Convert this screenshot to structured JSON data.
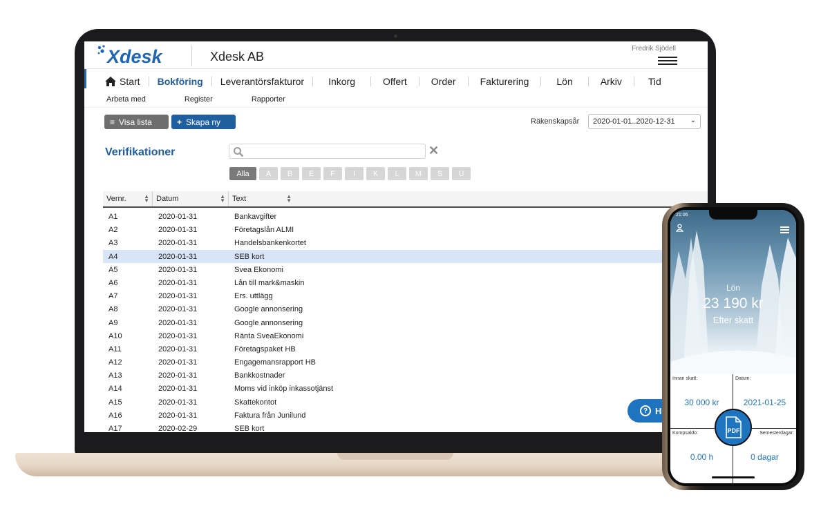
{
  "header": {
    "logo_text": "Xdesk",
    "company": "Xdesk AB",
    "user": "Fredrik Sjödell"
  },
  "nav": {
    "items": [
      {
        "label": "Start"
      },
      {
        "label": "Bokföring"
      },
      {
        "label": "Leverantörsfakturor"
      },
      {
        "label": "Inkorg"
      },
      {
        "label": "Offert"
      },
      {
        "label": "Order"
      },
      {
        "label": "Fakturering"
      },
      {
        "label": "Lön"
      },
      {
        "label": "Arkiv"
      },
      {
        "label": "Tid"
      }
    ],
    "active": "Bokföring",
    "sub_items": [
      {
        "label": "Arbeta med"
      },
      {
        "label": "Register"
      },
      {
        "label": "Rapporter"
      }
    ]
  },
  "toolbar": {
    "list_label": "Visa lista",
    "create_label": "Skapa ny",
    "year_label": "Räkenskapsår",
    "year_value": "2020-01-01..2020-12-31"
  },
  "page": {
    "title": "Verifikationer",
    "search_placeholder": ""
  },
  "letters": [
    "Alla",
    "A",
    "B",
    "E",
    "F",
    "I",
    "K",
    "L",
    "M",
    "S",
    "U"
  ],
  "table": {
    "columns": [
      "Vernr.",
      "Datum",
      "Text"
    ],
    "rows": [
      [
        "A1",
        "2020-01-31",
        "Bankavgifter"
      ],
      [
        "A2",
        "2020-01-31",
        "Företagslån ALMI"
      ],
      [
        "A3",
        "2020-01-31",
        "Handelsbankenkortet"
      ],
      [
        "A4",
        "2020-01-31",
        "SEB kort"
      ],
      [
        "A5",
        "2020-01-31",
        "Svea Ekonomi"
      ],
      [
        "A6",
        "2020-01-31",
        "Lån till mark&maskin"
      ],
      [
        "A7",
        "2020-01-31",
        "Ers. uttlägg"
      ],
      [
        "A8",
        "2020-01-31",
        "Google annonsering"
      ],
      [
        "A9",
        "2020-01-31",
        "Google annonsering"
      ],
      [
        "A10",
        "2020-01-31",
        "Ränta SveaEkonomi"
      ],
      [
        "A11",
        "2020-01-31",
        "Företagspaket HB"
      ],
      [
        "A12",
        "2020-01-31",
        "Engagemansrapport HB"
      ],
      [
        "A13",
        "2020-01-31",
        "Bankkostnader"
      ],
      [
        "A14",
        "2020-01-31",
        "Moms vid inköp inkassotjänst"
      ],
      [
        "A15",
        "2020-01-31",
        "Skattekontot"
      ],
      [
        "A16",
        "2020-01-31",
        "Faktura från Junilund"
      ],
      [
        "A17",
        "2020-02-29",
        "SEB kort"
      ]
    ],
    "selected_row": "A4"
  },
  "help": {
    "label": "H"
  },
  "phone": {
    "time": "21:06",
    "hero_title": "Lön",
    "hero_amount": "23 190 kr",
    "hero_sub": "Efter skatt",
    "tiles": [
      {
        "label": "Innan skatt:",
        "value": "30 000 kr"
      },
      {
        "label": "Datum:",
        "value": "2021-01-25"
      },
      {
        "label": "Kompsaldo:",
        "value": "0.00 h"
      },
      {
        "label": "Semesterdagar:",
        "value": "0 dagar"
      }
    ],
    "pdf_label": "PDF"
  },
  "colors": {
    "accent": "#215d9c",
    "button_blue": "#1f5f9f",
    "selected_row": "#d7e5f7",
    "phone_value": "#1f74c0"
  }
}
